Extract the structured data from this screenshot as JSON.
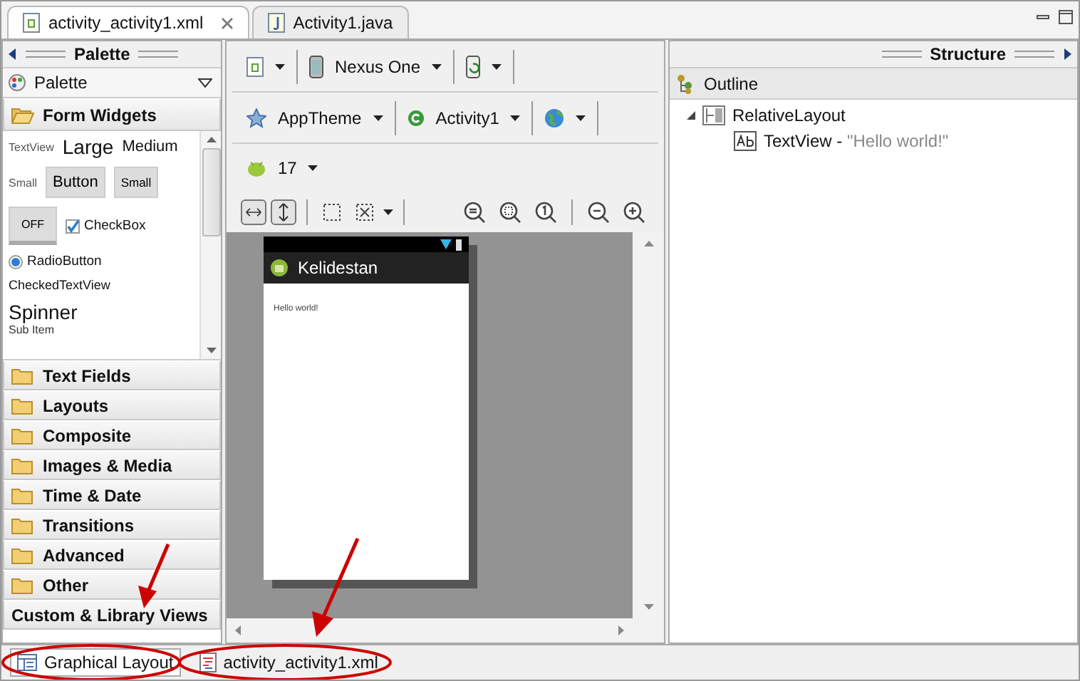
{
  "editor_tabs": [
    {
      "label": "activity_activity1.xml",
      "kind": "xml",
      "selected": true
    },
    {
      "label": "Activity1.java",
      "kind": "java",
      "selected": false
    }
  ],
  "palette": {
    "header": "Palette",
    "dropdown": "Palette",
    "open_category": "Form Widgets",
    "widgets": {
      "textview": "TextView",
      "large": "Large",
      "medium": "Medium",
      "small_label": "Small",
      "button": "Button",
      "small_button": "Small",
      "toggle": "OFF",
      "checkbox": {
        "label": "CheckBox",
        "checked": true
      },
      "radio": {
        "label": "RadioButton",
        "selected": true
      },
      "checked_text_view": "CheckedTextView",
      "spinner": "Spinner",
      "sub_item": "Sub Item"
    },
    "categories": [
      {
        "label": "Text Fields",
        "kind": "folder"
      },
      {
        "label": "Layouts",
        "kind": "folder"
      },
      {
        "label": "Composite",
        "kind": "folder"
      },
      {
        "label": "Images & Media",
        "kind": "folder"
      },
      {
        "label": "Time & Date",
        "kind": "folder"
      },
      {
        "label": "Transitions",
        "kind": "folder"
      },
      {
        "label": "Advanced",
        "kind": "folder"
      },
      {
        "label": "Other",
        "kind": "folder"
      },
      {
        "label": "Custom & Library Views",
        "kind": "plain"
      }
    ]
  },
  "toolbar": {
    "device": "Nexus One",
    "theme": "AppTheme",
    "activity": "Activity1",
    "api_level": "17"
  },
  "canvas": {
    "app_title": "Kelidestan",
    "text": "Hello world!"
  },
  "structure": {
    "header": "Structure",
    "outline": "Outline",
    "tree": [
      {
        "label": "RelativeLayout",
        "kind": "layout",
        "expanded": true,
        "children": [
          {
            "label": "TextView",
            "kind": "text",
            "separator": "-",
            "detail": "\"Hello world!\""
          }
        ]
      }
    ]
  },
  "bottom_tabs": [
    {
      "label": "Graphical Layout",
      "kind": "layout",
      "selected": true
    },
    {
      "label": "activity_activity1.xml",
      "kind": "xml",
      "selected": false
    }
  ]
}
